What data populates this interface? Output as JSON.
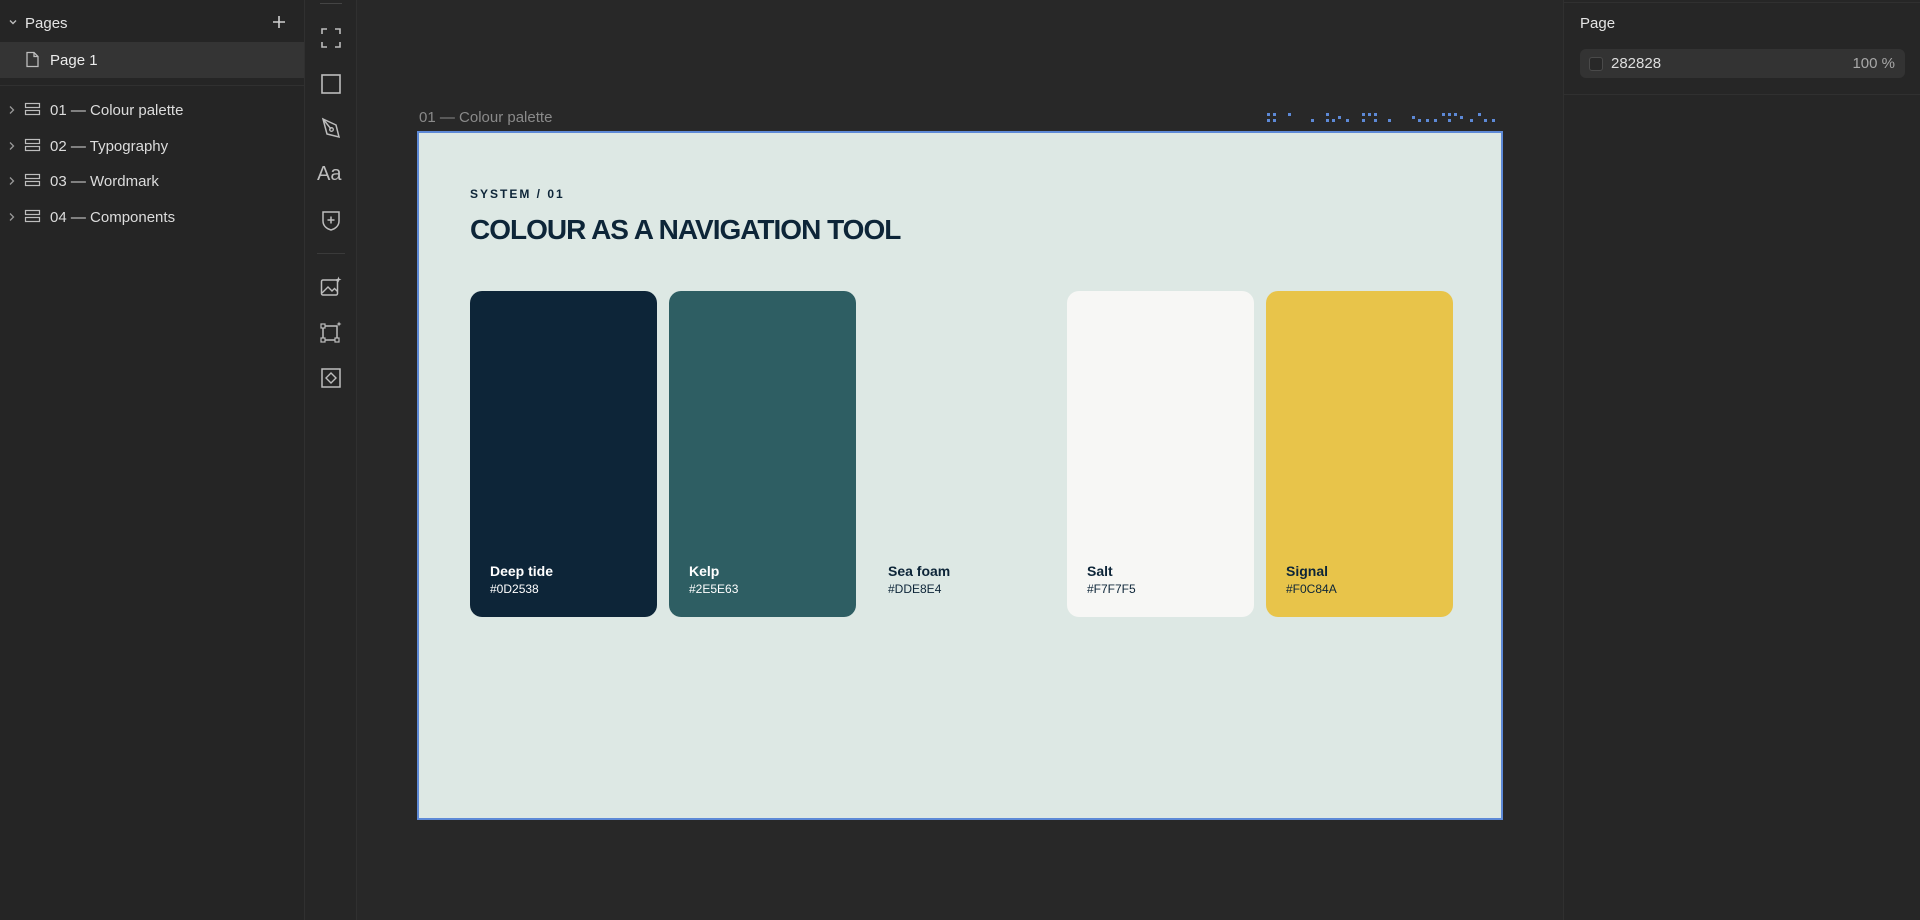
{
  "sidebar": {
    "pages_title": "Pages",
    "pages": [
      {
        "label": "Page 1"
      }
    ],
    "layers": [
      {
        "label": "01 — Colour palette"
      },
      {
        "label": "02 — Typography"
      },
      {
        "label": "03 — Wordmark"
      },
      {
        "label": "04 — Components"
      }
    ]
  },
  "toolrail": {
    "text_tool_label": "Aa",
    "icons": [
      "frame-tool-icon",
      "rectangle-tool-icon",
      "pen-tool-icon",
      "text-tool-icon",
      "component-add-icon",
      "image-ai-icon",
      "frame-ai-icon",
      "component-icon"
    ]
  },
  "canvas": {
    "frame_title": "01 — Colour palette",
    "artboard": {
      "background": "#DDE8E4",
      "eyebrow": "SYSTEM / 01",
      "headline": "COLOUR AS A NAVIGATION TOOL",
      "swatches": [
        {
          "name": "Deep tide",
          "hex": "#0D2538",
          "color": "#0D2538",
          "text_color": "#ffffff"
        },
        {
          "name": "Kelp",
          "hex": "#2E5E63",
          "color": "#2E5E63",
          "text_color": "#ffffff"
        },
        {
          "name": "Sea foam",
          "hex": "#DDE8E4",
          "color": "#DDE8E4",
          "text_color": "#0D2538"
        },
        {
          "name": "Salt",
          "hex": "#F7F7F5",
          "color": "#F7F7F5",
          "text_color": "#0D2538"
        },
        {
          "name": "Signal",
          "hex": "#F0C84A",
          "color": "#E8C44A",
          "text_color": "#0D2538"
        }
      ]
    }
  },
  "rightpanel": {
    "title": "Page",
    "fill": {
      "hex": "282828",
      "opacity": "100 %",
      "swatch_color": "#282828"
    }
  },
  "colors": {
    "selection": "#5d89d6",
    "ui_bg": "#282828"
  }
}
